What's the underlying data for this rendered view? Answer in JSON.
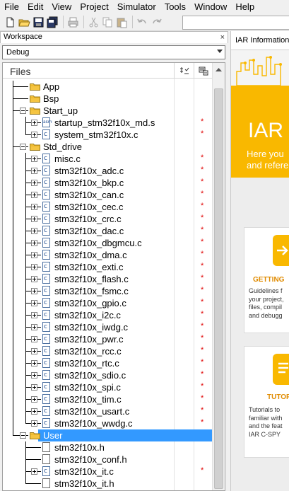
{
  "menubar": [
    "File",
    "Edit",
    "View",
    "Project",
    "Simulator",
    "Tools",
    "Window",
    "Help"
  ],
  "workspace": {
    "title": "Workspace",
    "close": "×",
    "configuration": "Debug",
    "files_header": "Files"
  },
  "tree": [
    {
      "label": "App",
      "type": "folder",
      "depth": 1,
      "expander": "none"
    },
    {
      "label": "Bsp",
      "type": "folder",
      "depth": 1,
      "expander": "none"
    },
    {
      "label": "Start_up",
      "type": "folder",
      "depth": 1,
      "expander": "minus"
    },
    {
      "label": "startup_stm32f10x_md.s",
      "type": "asm",
      "depth": 2,
      "expander": "plus",
      "modified": true
    },
    {
      "label": "system_stm32f10x.c",
      "type": "c",
      "depth": 2,
      "expander": "plus",
      "modified": true
    },
    {
      "label": "Std_drive",
      "type": "folder",
      "depth": 1,
      "expander": "minus"
    },
    {
      "label": "misc.c",
      "type": "c",
      "depth": 2,
      "expander": "plus",
      "modified": true
    },
    {
      "label": "stm32f10x_adc.c",
      "type": "c",
      "depth": 2,
      "expander": "plus",
      "modified": true
    },
    {
      "label": "stm32f10x_bkp.c",
      "type": "c",
      "depth": 2,
      "expander": "plus",
      "modified": true
    },
    {
      "label": "stm32f10x_can.c",
      "type": "c",
      "depth": 2,
      "expander": "plus",
      "modified": true
    },
    {
      "label": "stm32f10x_cec.c",
      "type": "c",
      "depth": 2,
      "expander": "plus",
      "modified": true
    },
    {
      "label": "stm32f10x_crc.c",
      "type": "c",
      "depth": 2,
      "expander": "plus",
      "modified": true
    },
    {
      "label": "stm32f10x_dac.c",
      "type": "c",
      "depth": 2,
      "expander": "plus",
      "modified": true
    },
    {
      "label": "stm32f10x_dbgmcu.c",
      "type": "c",
      "depth": 2,
      "expander": "plus",
      "modified": true
    },
    {
      "label": "stm32f10x_dma.c",
      "type": "c",
      "depth": 2,
      "expander": "plus",
      "modified": true
    },
    {
      "label": "stm32f10x_exti.c",
      "type": "c",
      "depth": 2,
      "expander": "plus",
      "modified": true
    },
    {
      "label": "stm32f10x_flash.c",
      "type": "c",
      "depth": 2,
      "expander": "plus",
      "modified": true
    },
    {
      "label": "stm32f10x_fsmc.c",
      "type": "c",
      "depth": 2,
      "expander": "plus",
      "modified": true
    },
    {
      "label": "stm32f10x_gpio.c",
      "type": "c",
      "depth": 2,
      "expander": "plus",
      "modified": true
    },
    {
      "label": "stm32f10x_i2c.c",
      "type": "c",
      "depth": 2,
      "expander": "plus",
      "modified": true
    },
    {
      "label": "stm32f10x_iwdg.c",
      "type": "c",
      "depth": 2,
      "expander": "plus",
      "modified": true
    },
    {
      "label": "stm32f10x_pwr.c",
      "type": "c",
      "depth": 2,
      "expander": "plus",
      "modified": true
    },
    {
      "label": "stm32f10x_rcc.c",
      "type": "c",
      "depth": 2,
      "expander": "plus",
      "modified": true
    },
    {
      "label": "stm32f10x_rtc.c",
      "type": "c",
      "depth": 2,
      "expander": "plus",
      "modified": true
    },
    {
      "label": "stm32f10x_sdio.c",
      "type": "c",
      "depth": 2,
      "expander": "plus",
      "modified": true
    },
    {
      "label": "stm32f10x_spi.c",
      "type": "c",
      "depth": 2,
      "expander": "plus",
      "modified": true
    },
    {
      "label": "stm32f10x_tim.c",
      "type": "c",
      "depth": 2,
      "expander": "plus",
      "modified": true
    },
    {
      "label": "stm32f10x_usart.c",
      "type": "c",
      "depth": 2,
      "expander": "plus",
      "modified": true
    },
    {
      "label": "stm32f10x_wwdg.c",
      "type": "c",
      "depth": 2,
      "expander": "plus",
      "modified": true
    },
    {
      "label": "User",
      "type": "folder",
      "depth": 1,
      "expander": "minus",
      "selected": true
    },
    {
      "label": "stm32f10x.h",
      "type": "h",
      "depth": 2,
      "expander": "none"
    },
    {
      "label": "stm32f10x_conf.h",
      "type": "h",
      "depth": 2,
      "expander": "none"
    },
    {
      "label": "stm32f10x_it.c",
      "type": "c",
      "depth": 2,
      "expander": "plus",
      "modified": true
    },
    {
      "label": "stm32f10x_it.h",
      "type": "h",
      "depth": 2,
      "expander": "none"
    }
  ],
  "modified_mark": "*",
  "info": {
    "tab": "IAR Information",
    "banner_title": "IAR",
    "banner_lines": [
      "Here you",
      "and refere"
    ],
    "card1_title": "GETTING",
    "card1_lines": [
      "Guidelines f",
      "your project,",
      "files, compil",
      "and debugg"
    ],
    "card2_title": "TUTOR",
    "card2_lines": [
      "Tutorials to",
      "familiar with",
      "and the feat",
      "IAR C-SPY"
    ]
  },
  "colors": {
    "selection": "#3399ff",
    "modified_mark": "#e00000",
    "iar_yellow": "#f9b800",
    "folder": "#f5c542"
  }
}
